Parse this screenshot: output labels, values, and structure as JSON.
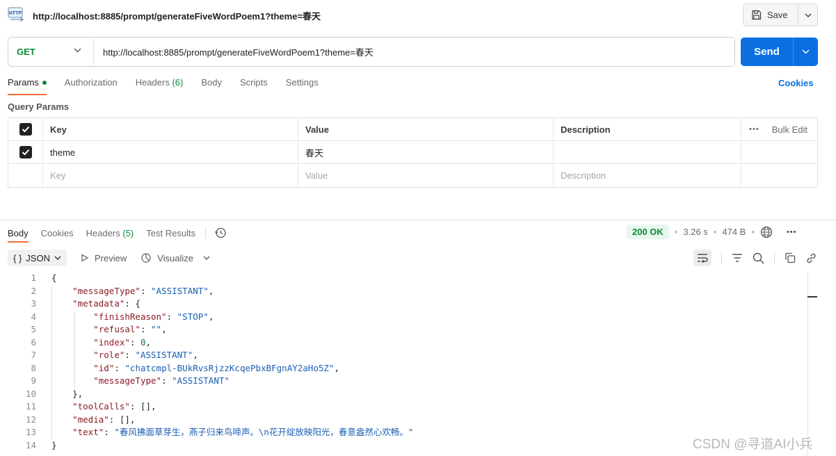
{
  "title_bar": {
    "url": "http://localhost:8885/prompt/generateFiveWordPoem1?theme=春天",
    "save_label": "Save"
  },
  "request": {
    "method": "GET",
    "url": "http://localhost:8885/prompt/generateFiveWordPoem1?theme=春天",
    "send_label": "Send"
  },
  "request_tabs": {
    "params": "Params",
    "authorization": "Authorization",
    "headers": "Headers",
    "headers_count": "(6)",
    "body": "Body",
    "scripts": "Scripts",
    "settings": "Settings",
    "cookies": "Cookies"
  },
  "query_params": {
    "label": "Query Params",
    "headers": {
      "key": "Key",
      "value": "Value",
      "description": "Description",
      "bulk_edit": "Bulk Edit"
    },
    "rows": [
      {
        "checked": true,
        "key": "theme",
        "value": "春天",
        "description": ""
      }
    ],
    "placeholders": {
      "key": "Key",
      "value": "Value",
      "description": "Description"
    }
  },
  "response_tabs": {
    "body": "Body",
    "cookies": "Cookies",
    "headers": "Headers",
    "headers_count": "(5)",
    "test_results": "Test Results"
  },
  "response_status": {
    "status": "200 OK",
    "time": "3.26 s",
    "size": "474 B"
  },
  "view_bar": {
    "format": "JSON",
    "format_icon": "{ }",
    "preview": "Preview",
    "visualize": "Visualize"
  },
  "code": {
    "lines": [
      "1",
      "2",
      "3",
      "4",
      "5",
      "6",
      "7",
      "8",
      "9",
      "10",
      "11",
      "12",
      "13",
      "14"
    ],
    "messageType": "ASSISTANT",
    "finishReason": "STOP",
    "refusal": "",
    "index": "0",
    "role": "ASSISTANT",
    "id": "chatcmpl-BUkRvsRjzzKcqePbxBFgnAY2aHo5Z",
    "meta_messageType": "ASSISTANT",
    "text": "春风拂面草芽生，燕子归来鸟啼声。\\n花开绽放映阳光，春意盎然心欢畅。"
  },
  "watermark": "CSDN @寻道AI小兵",
  "colors": {
    "accent_blue": "#0b6fe0",
    "method_green": "#0b8a3a",
    "tab_orange": "#f26b3a"
  }
}
